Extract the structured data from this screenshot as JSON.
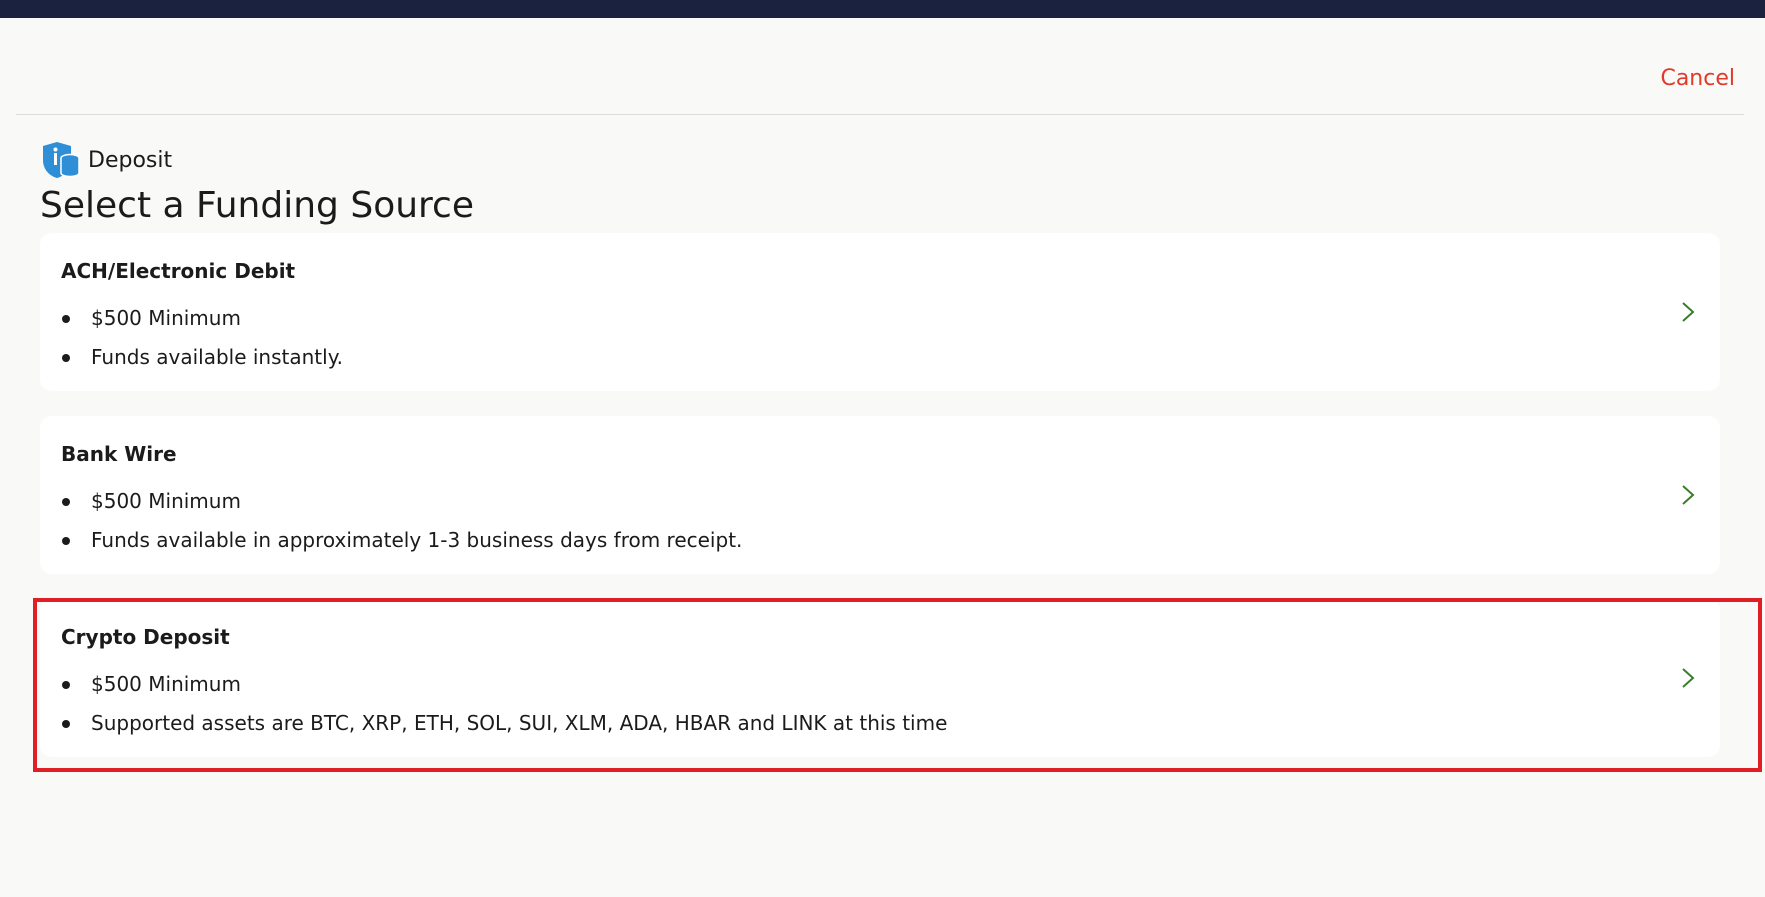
{
  "header": {
    "cancel_label": "Cancel"
  },
  "page": {
    "section_label": "Deposit",
    "title": "Select a Funding Source"
  },
  "colors": {
    "topbar": "#1a2240",
    "cancel": "#e03a2a",
    "chevron": "#3a7d2a",
    "icon": "#2e8fd6",
    "highlight": "#e01e26"
  },
  "funding_sources": [
    {
      "title": "ACH/Electronic Debit",
      "bullets": [
        "$500 Minimum",
        "Funds available instantly."
      ],
      "icon": "chevron-right-icon"
    },
    {
      "title": "Bank Wire",
      "bullets": [
        "$500 Minimum",
        "Funds available in approximately 1-3 business days from receipt."
      ],
      "icon": "chevron-right-icon"
    },
    {
      "title": "Crypto Deposit",
      "bullets": [
        "$500 Minimum",
        "Supported assets are BTC, XRP, ETH, SOL, SUI, XLM, ADA, HBAR and LINK at this time"
      ],
      "icon": "chevron-right-icon"
    }
  ]
}
